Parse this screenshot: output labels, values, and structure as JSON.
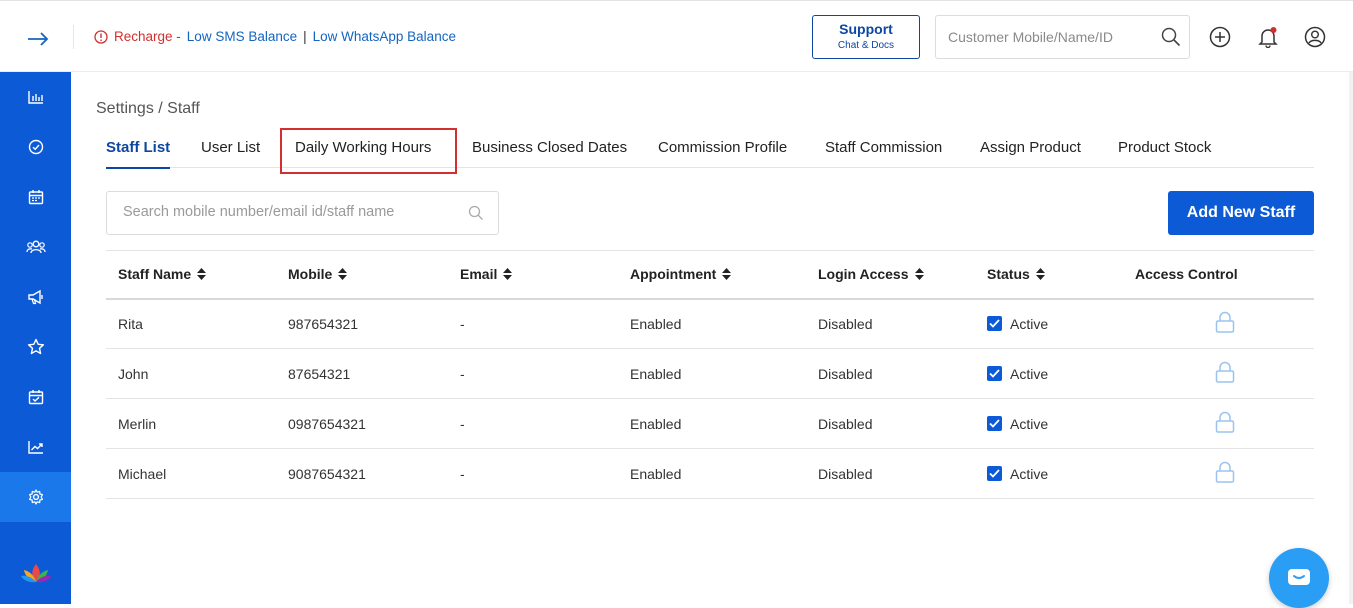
{
  "header": {
    "recharge_label": "Recharge -",
    "low_sms": "Low SMS Balance",
    "separator": "|",
    "low_whatsapp": "Low WhatsApp Balance",
    "support_title": "Support",
    "support_subtitle": "Chat & Docs",
    "customer_search_placeholder": "Customer Mobile/Name/ID"
  },
  "sidebar": {
    "items": [
      {
        "icon": "bar-chart-icon"
      },
      {
        "icon": "check-circle-icon"
      },
      {
        "icon": "calendar-icon"
      },
      {
        "icon": "users-icon"
      },
      {
        "icon": "megaphone-icon"
      },
      {
        "icon": "star-icon"
      },
      {
        "icon": "calendar-check-icon"
      },
      {
        "icon": "trend-icon"
      },
      {
        "icon": "gear-icon",
        "active": true
      }
    ]
  },
  "breadcrumb": "Settings  /  Staff",
  "tabs": [
    {
      "label": "Staff List",
      "active": true
    },
    {
      "label": "User List"
    },
    {
      "label": "Daily Working Hours",
      "highlighted": true
    },
    {
      "label": "Business Closed Dates"
    },
    {
      "label": "Commission Profile"
    },
    {
      "label": "Staff Commission"
    },
    {
      "label": "Assign Product"
    },
    {
      "label": "Product Stock"
    }
  ],
  "staff_search_placeholder": "Search mobile number/email id/staff name",
  "add_button_label": "Add New Staff",
  "table": {
    "columns": [
      "Staff Name",
      "Mobile",
      "Email",
      "Appointment",
      "Login Access",
      "Status",
      "Access Control"
    ],
    "rows": [
      {
        "name": "Rita",
        "mobile": "987654321",
        "email": "-",
        "appointment": "Enabled",
        "login": "Disabled",
        "status": "Active"
      },
      {
        "name": "John",
        "mobile": "87654321",
        "email": "-",
        "appointment": "Enabled",
        "login": "Disabled",
        "status": "Active"
      },
      {
        "name": "Merlin",
        "mobile": "0987654321",
        "email": "-",
        "appointment": "Enabled",
        "login": "Disabled",
        "status": "Active"
      },
      {
        "name": "Michael",
        "mobile": "9087654321",
        "email": "-",
        "appointment": "Enabled",
        "login": "Disabled",
        "status": "Active"
      }
    ]
  },
  "colors": {
    "primary": "#0d5ad6",
    "sidebar_active": "#1a78ea",
    "alert_red": "#d32f2f",
    "link_blue": "#1565c0",
    "chat_fab": "#2a9df4"
  }
}
